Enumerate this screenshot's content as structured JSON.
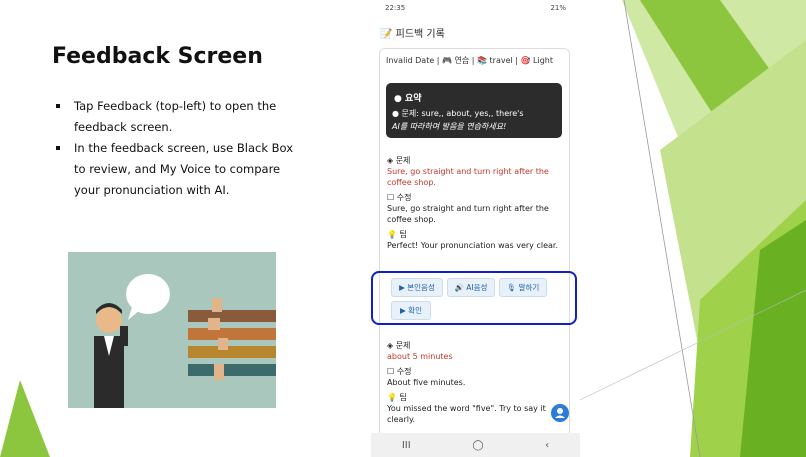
{
  "slide": {
    "title": "Feedback Screen",
    "bullets": [
      "Tap Feedback (top-left) to open the feedback screen.",
      "In the feedback screen, use Black Box to review, and My Voice to compare your pronunciation with AI."
    ]
  },
  "phone": {
    "status_time": "22:35",
    "status_right": "21%",
    "header_title": "피드백 기록",
    "meta": "Invalid Date | 🎮 연습 | 📚 travel | 🎯 Light",
    "summary": {
      "heading": "요약",
      "problems": "● 문제: sure,, about, yes,, there's",
      "hint": "AI를 따라하며 발음을 연습하세요!"
    },
    "entries": [
      {
        "problem_label": "◈ 문제",
        "problem_text": "Sure, go straight and turn right after the coffee shop.",
        "fix_label": "☐ 수정",
        "fix_text": "Sure, go straight and turn right after the coffee shop.",
        "tip_label": "💡 팁",
        "tip_text": "Perfect! Your pronunciation was very clear."
      },
      {
        "problem_label": "◈ 문제",
        "problem_text": "about 5 minutes",
        "fix_label": "☐ 수정",
        "fix_text": "About five minutes.",
        "tip_label": "💡 팁",
        "tip_text": "You missed the word \"five\". Try to say it clearly."
      }
    ],
    "buttons": {
      "my_voice": "▶ 본인음성",
      "ai_voice": "🔊 AI음성",
      "speak": "🎙 말하기",
      "confirm": "▶ 확인"
    },
    "nav": {
      "recent": "III",
      "home": "◯",
      "back": "‹"
    }
  },
  "colors": {
    "highlight": "#1020c8",
    "problem_text": "#c0392b",
    "button_text": "#1a5fa8",
    "green_accent": "#8cc63f"
  }
}
